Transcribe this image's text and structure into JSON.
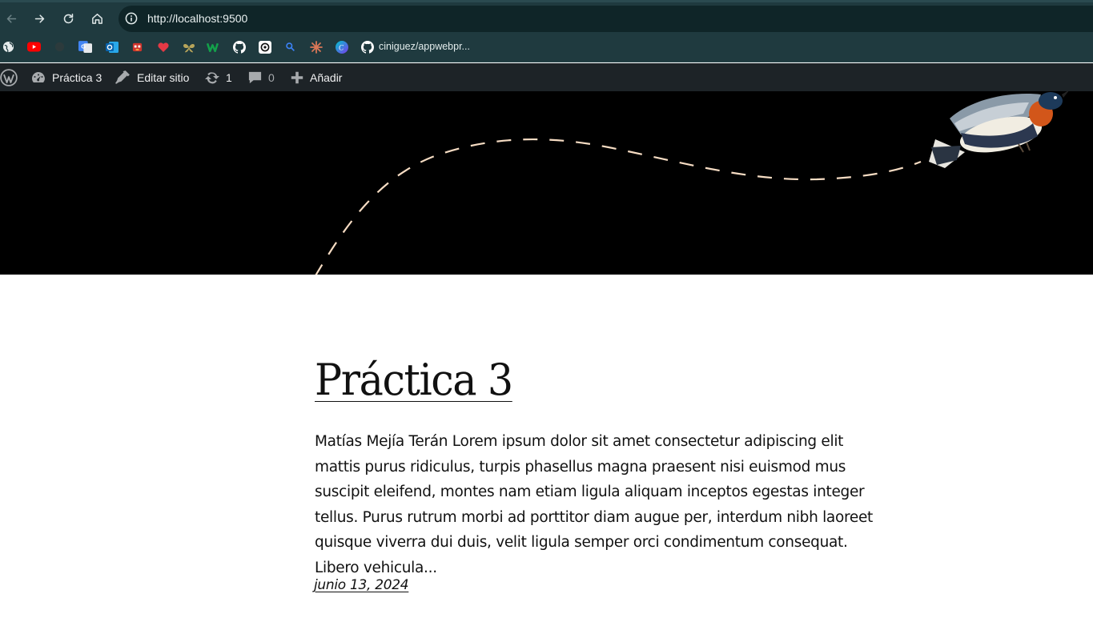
{
  "browser": {
    "url": "http://localhost:9500",
    "nav": {
      "back": "back-arrow-icon",
      "forward": "forward-arrow-icon",
      "reload": "reload-icon",
      "home": "home-icon"
    },
    "bookmarks": [
      {
        "icon": "globe-icon"
      },
      {
        "icon": "youtube-icon",
        "color": "#ff0000"
      },
      {
        "icon": "dark-blank-icon"
      },
      {
        "icon": "google-translate-icon",
        "color": "#4285f4"
      },
      {
        "icon": "outlook-icon",
        "color": "#0a64ad"
      },
      {
        "icon": "bot-icon",
        "color": "#d0342c"
      },
      {
        "icon": "heart-icon",
        "color": "#e53945"
      },
      {
        "icon": "butterfly-icon",
        "color": "#b7a45a"
      },
      {
        "icon": "w-logo-icon",
        "color": "#13a04a"
      },
      {
        "icon": "github-icon"
      },
      {
        "icon": "openai-icon"
      },
      {
        "icon": "magnifier-icon",
        "color": "#3b82f6"
      },
      {
        "icon": "starburst-icon",
        "color": "#d97757"
      },
      {
        "icon": "c-logo-icon",
        "color": "#7c3aed"
      },
      {
        "icon": "github-icon",
        "label": "ciniguez/appwebpr..."
      }
    ]
  },
  "adminbar": {
    "site_name": "Práctica 3",
    "edit_site": "Editar sitio",
    "updates_count": "1",
    "comments_count": "0",
    "add_new": "Añadir"
  },
  "post": {
    "title": "Práctica 3",
    "excerpt": "Matías Mejía Terán Lorem ipsum dolor sit amet consectetur adipiscing elit mattis purus ridiculus, turpis phasellus magna praesent nisi euismod mus suscipit eleifend, montes nam etiam ligula aliquam inceptos egestas integer tellus. Purus rutrum morbi ad porttitor diam augue per, interdum nibh laoreet quisque viverra dui duis, velit ligula semper orci condimentum consequat. Libero vehicula...",
    "date": "junio 13, 2024"
  },
  "colors": {
    "chrome_bg": "#1f3a3f",
    "adminbar_bg": "#1d2327",
    "banner_bg": "#000000",
    "dash_line": "#f6dcc3"
  }
}
